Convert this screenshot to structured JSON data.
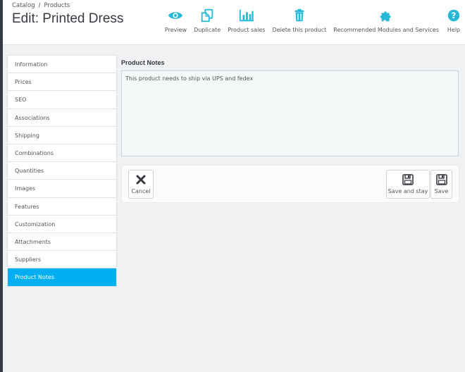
{
  "breadcrumb": {
    "first": "Catalog",
    "separator": "/",
    "second": "Products"
  },
  "page_title": "Edit: Printed Dress",
  "toolbar": [
    {
      "label": "Preview",
      "icon": "eye-icon"
    },
    {
      "label": "Duplicate",
      "icon": "copy-icon"
    },
    {
      "label": "Product sales",
      "icon": "bar-chart-icon"
    },
    {
      "label": "Delete this product",
      "icon": "trash-icon"
    },
    {
      "label": "Recommended Modules and Services",
      "icon": "puzzle-icon"
    },
    {
      "label": "Help",
      "icon": "help-icon"
    }
  ],
  "sidebar": {
    "items": [
      {
        "label": "Information"
      },
      {
        "label": "Prices"
      },
      {
        "label": "SEO"
      },
      {
        "label": "Associations"
      },
      {
        "label": "Shipping"
      },
      {
        "label": "Combinations"
      },
      {
        "label": "Quantities"
      },
      {
        "label": "Images"
      },
      {
        "label": "Features"
      },
      {
        "label": "Customization"
      },
      {
        "label": "Attachments"
      },
      {
        "label": "Suppliers"
      },
      {
        "label": "Product Notes"
      }
    ],
    "active": "Product Notes"
  },
  "main": {
    "section_title": "Product Notes",
    "notes_value": "This product needs to ship via UPS and fedex"
  },
  "footer": {
    "cancel_label": "Cancel",
    "save_stay_label": "Save and stay",
    "save_label": "Save"
  },
  "colors": {
    "accent": "#25b9d7",
    "active_tab": "#00aff0",
    "header_dark": "#363a41"
  }
}
